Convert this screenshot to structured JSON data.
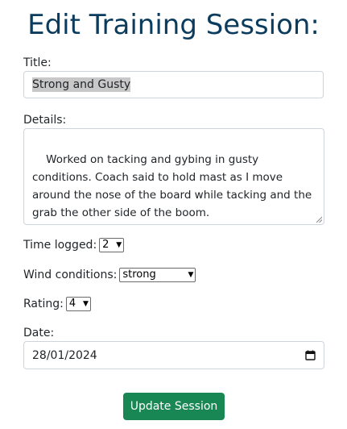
{
  "page": {
    "heading": "Edit Training Session:"
  },
  "form": {
    "title_label": "Title:",
    "title_value": "Strong and Gusty",
    "details_label": "Details:",
    "details_value": "Worked on tacking and gybing in gusty conditions. Coach said to hold mast as I move around the nose of the board while tacking and the grab the other side of the boom.\nWind was strong and gusty - lots of fun!",
    "time_label": "Time logged:",
    "time_value": "2",
    "wind_label": "Wind conditions:",
    "wind_value": "strong",
    "rating_label": "Rating:",
    "rating_value": "4",
    "date_label": "Date:",
    "date_value": "28/01/2024",
    "submit_label": "Update Session"
  },
  "icons": {
    "select_chevron": "chevron-down-icon",
    "calendar": "calendar-icon"
  },
  "colors": {
    "heading": "#0b3c5d",
    "submit_bg": "#198754",
    "selection": "#c8c8c8"
  }
}
